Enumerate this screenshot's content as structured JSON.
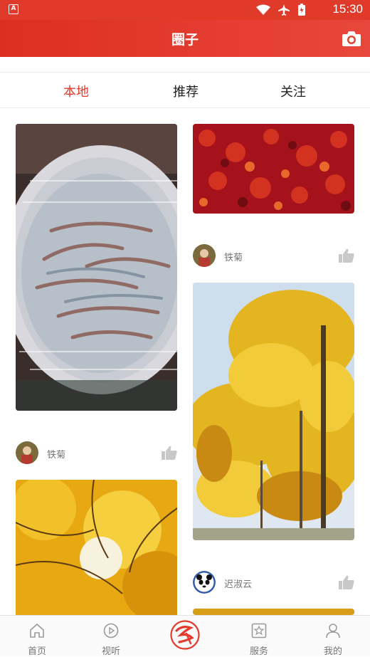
{
  "statusbar": {
    "time": "15:30",
    "app_letter": "A"
  },
  "header": {
    "title": "圈子"
  },
  "tabs": [
    {
      "label": "本地"
    },
    {
      "label": "推荐"
    },
    {
      "label": "关注"
    }
  ],
  "feed": [
    {
      "caption": "",
      "user": "铁菊"
    },
    {
      "caption": "",
      "user": "铁菊"
    },
    {
      "caption": "",
      "user": "迟淑云"
    }
  ],
  "tabbar": {
    "home": "首页",
    "media": "视听",
    "service": "服务",
    "mine": "我的"
  },
  "colors": {
    "brand": "#e03a2a",
    "active_tab": "#e23a2c",
    "inactive": "#777777"
  }
}
